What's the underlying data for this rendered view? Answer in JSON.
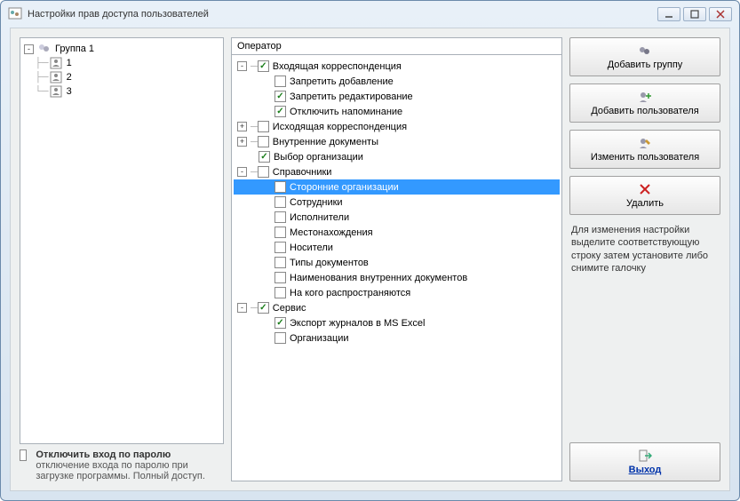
{
  "window": {
    "title": "Настройки прав доступа пользователей"
  },
  "left": {
    "group_expanded": "-",
    "group_label": "Группа 1",
    "users": [
      "1",
      "2",
      "3"
    ]
  },
  "footer": {
    "toggle_label": "Отключить вход по паролю",
    "toggle_desc": "отключение входа по паролю при загрузке программы. Полный доступ."
  },
  "mid": {
    "header": "Оператор",
    "nodes": {
      "n0": {
        "exp": "-",
        "checked": true,
        "label": "Входящая корреспонденция"
      },
      "n0_0": {
        "checked": false,
        "label": "Запретить добавление"
      },
      "n0_1": {
        "checked": true,
        "label": "Запретить редактирование"
      },
      "n0_2": {
        "checked": true,
        "label": "Отключить напоминание"
      },
      "n1": {
        "exp": "+",
        "checked": false,
        "label": "Исходящая корреспонденция"
      },
      "n2": {
        "exp": "+",
        "checked": false,
        "label": "Внутренние документы"
      },
      "n3": {
        "checked": true,
        "label": "Выбор организации"
      },
      "n4": {
        "exp": "-",
        "checked": false,
        "label": "Справочники"
      },
      "n4_0": {
        "checked": false,
        "label": "Сторонние организации"
      },
      "n4_1": {
        "checked": false,
        "label": "Сотрудники"
      },
      "n4_2": {
        "checked": false,
        "label": "Исполнители"
      },
      "n4_3": {
        "checked": false,
        "label": "Местонахождения"
      },
      "n4_4": {
        "checked": false,
        "label": "Носители"
      },
      "n4_5": {
        "checked": false,
        "label": "Типы документов"
      },
      "n4_6": {
        "checked": false,
        "label": "Наименования внутренних документов"
      },
      "n4_7": {
        "checked": false,
        "label": "На кого распространяются"
      },
      "n5": {
        "exp": "-",
        "checked": true,
        "label": "Сервис"
      },
      "n5_0": {
        "checked": true,
        "label": "Экспорт журналов в MS Excel"
      },
      "n5_1": {
        "checked": false,
        "label": "Организации"
      }
    }
  },
  "right": {
    "btn_add_group": "Добавить группу",
    "btn_add_user": "Добавить пользователя",
    "btn_edit_user": "Изменить пользователя",
    "btn_delete": "Удалить",
    "hint": "Для изменения настройки выделите соответствующую строку затем установите либо снимите галочку",
    "btn_exit": "Выход"
  }
}
